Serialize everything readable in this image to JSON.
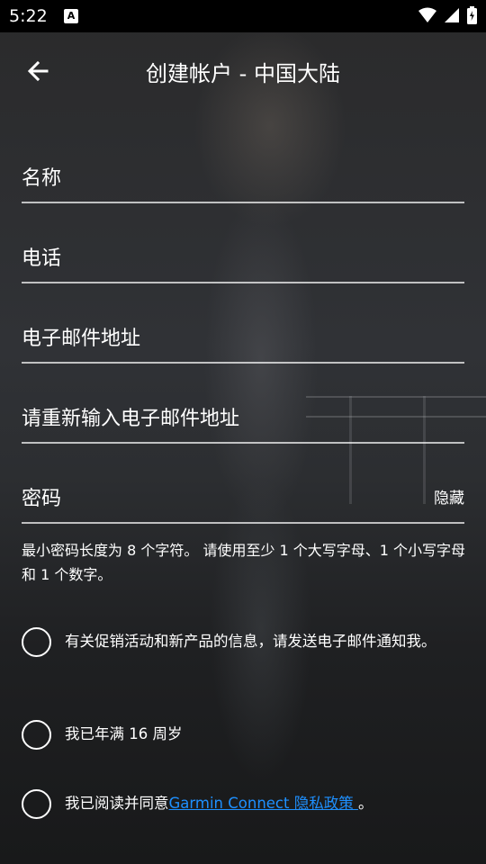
{
  "status_bar": {
    "time": "5:22",
    "sim_icon": "A"
  },
  "header": {
    "title": "创建帐户 - 中国大陆"
  },
  "form": {
    "name_label": "名称",
    "phone_label": "电话",
    "email_label": "电子邮件地址",
    "email_confirm_label": "请重新输入电子邮件地址",
    "password_label": "密码",
    "password_toggle": "隐藏",
    "password_hint": "最小密码长度为 8 个字符。 请使用至少 1 个大写字母、1 个小写字母和 1 个数字。"
  },
  "checks": {
    "promo": "有关促销活动和新产品的信息，请发送电子邮件通知我。",
    "age": "我已年满 16 周岁",
    "privacy_prefix": "我已阅读并同意",
    "privacy_link": "Garmin Connect 隐私政策 ",
    "privacy_suffix": "。"
  },
  "colors": {
    "link": "#1e90ff",
    "statusbar_bg": "#000000"
  }
}
